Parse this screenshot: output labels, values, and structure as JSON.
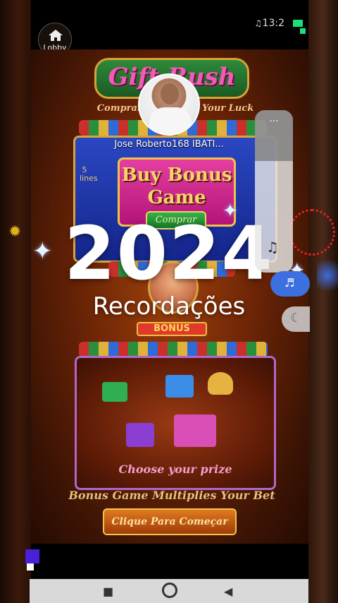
{
  "status_bar": {
    "time": "13:2",
    "volume_icon": "speaker-icon"
  },
  "lobby": {
    "label": "Lobby"
  },
  "game": {
    "title": "Gift Rush",
    "subtitle": "Comprar Bônus … e Your Luck",
    "buy_text": "Buy Bonus Game",
    "buy_button": "Comprar",
    "side_text": "5 lines",
    "bonus_label": "BONUS",
    "choose_text": "Choose your prize",
    "tagline": "Bonus Game   Multiplies Your Bet",
    "start_button": "Clique Para Começar"
  },
  "overlay": {
    "username": "Jose Roberto168 IBATI...",
    "year": "2024",
    "caption": "Recordações"
  },
  "side_controls": {
    "menu_dots": "···",
    "music_icon": "♫",
    "bell_icon": "🔕",
    "moon_icon": "☾"
  },
  "nav": {
    "recent": "■",
    "home": "●",
    "back": "◀"
  }
}
